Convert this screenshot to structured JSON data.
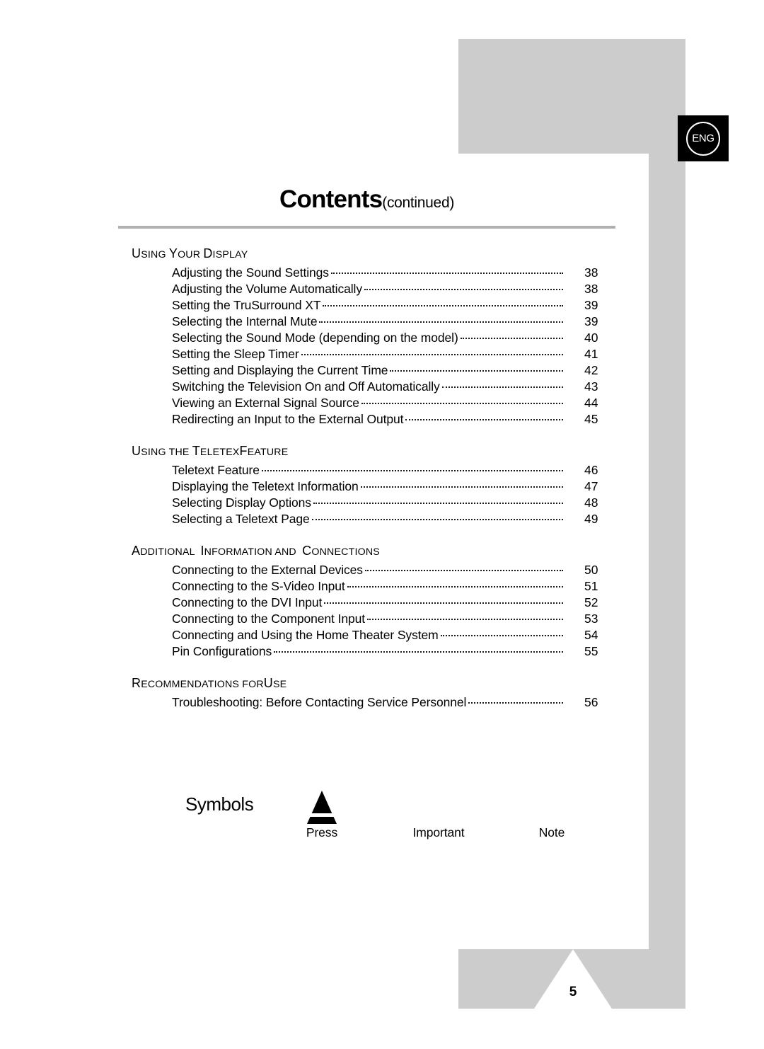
{
  "badge": {
    "language": "ENG"
  },
  "title": {
    "main": "Contents",
    "sub": "(continued)"
  },
  "footer": {
    "page_number": "5"
  },
  "colors": {
    "gray_block": "#cccccc",
    "rule": "#b0b0b0",
    "text": "#000000"
  },
  "toc": {
    "sections": [
      {
        "heading_parts": [
          {
            "text": "U",
            "style": "cap"
          },
          {
            "text": "SING ",
            "style": "sc"
          },
          {
            "text": "Y",
            "style": "cap"
          },
          {
            "text": "OUR ",
            "style": "sc"
          },
          {
            "text": "D",
            "style": "cap"
          },
          {
            "text": "ISPLAY",
            "style": "sc"
          }
        ],
        "heading_text": "USING YOUR DISPLAY",
        "entries": [
          {
            "label": "Adjusting the Sound Settings",
            "page": "38"
          },
          {
            "label": "Adjusting the Volume Automatically",
            "page": "38"
          },
          {
            "label": "Setting the TruSurround XT",
            "page": "39"
          },
          {
            "label": "Selecting the Internal Mute",
            "page": "39"
          },
          {
            "label": "Selecting the Sound Mode (depending on the model)",
            "page": "40"
          },
          {
            "label": "Setting the Sleep Timer",
            "page": "41"
          },
          {
            "label": "Setting and Displaying the Current Time",
            "page": "42"
          },
          {
            "label": "Switching the Television On and Off Automatically",
            "page": "43"
          },
          {
            "label": "Viewing an External Signal Source",
            "page": "44"
          },
          {
            "label": "Redirecting an Input to the External Output",
            "page": "45"
          }
        ]
      },
      {
        "heading_parts": [
          {
            "text": "U",
            "style": "cap"
          },
          {
            "text": "SING THE ",
            "style": "sc"
          },
          {
            "text": "T",
            "style": "cap"
          },
          {
            "text": "ELETEX",
            "style": "sc"
          },
          {
            "text": "F",
            "style": "cap"
          },
          {
            "text": "EATURE",
            "style": "sc"
          }
        ],
        "heading_text": "USING THE TELETEXT FEATURE",
        "entries": [
          {
            "label": "Teletext Feature",
            "page": "46"
          },
          {
            "label": "Displaying the Teletext Information",
            "page": "47"
          },
          {
            "label": "Selecting Display Options",
            "page": "48"
          },
          {
            "label": "Selecting a Teletext Page",
            "page": "49"
          }
        ]
      },
      {
        "heading_parts": [
          {
            "text": "A",
            "style": "cap"
          },
          {
            "text": "DDITIONAL  ",
            "style": "sc"
          },
          {
            "text": "I",
            "style": "cap"
          },
          {
            "text": "NFORMATION AND  ",
            "style": "sc"
          },
          {
            "text": "C",
            "style": "cap"
          },
          {
            "text": "ONNECTIONS",
            "style": "sc"
          }
        ],
        "heading_text": "ADDITIONAL INFORMATION AND CONNECTIONS",
        "entries": [
          {
            "label": "Connecting to the External Devices",
            "page": "50"
          },
          {
            "label": "Connecting to the S-Video Input",
            "page": "51"
          },
          {
            "label": "Connecting to the DVI Input",
            "page": "52"
          },
          {
            "label": "Connecting to the Component Input",
            "page": "53"
          },
          {
            "label": "Connecting and Using the Home Theater System",
            "page": "54"
          },
          {
            "label": "Pin Configurations",
            "page": "55"
          }
        ]
      },
      {
        "heading_parts": [
          {
            "text": "R",
            "style": "cap"
          },
          {
            "text": "ECOMMENDATIONS FOR",
            "style": "sc"
          },
          {
            "text": "U",
            "style": "cap"
          },
          {
            "text": "SE",
            "style": "sc"
          }
        ],
        "heading_text": "RECOMMENDATIONS FOR USE",
        "entries": [
          {
            "label": "Troubleshooting: Before Contacting Service Personnel",
            "page": "56"
          }
        ]
      }
    ]
  },
  "symbols": {
    "label": "Symbols",
    "items": [
      {
        "caption": "Press",
        "icon": "press-triangle-icon"
      },
      {
        "caption": "Important",
        "icon": "important-icon"
      },
      {
        "caption": "Note",
        "icon": "note-icon"
      }
    ]
  }
}
